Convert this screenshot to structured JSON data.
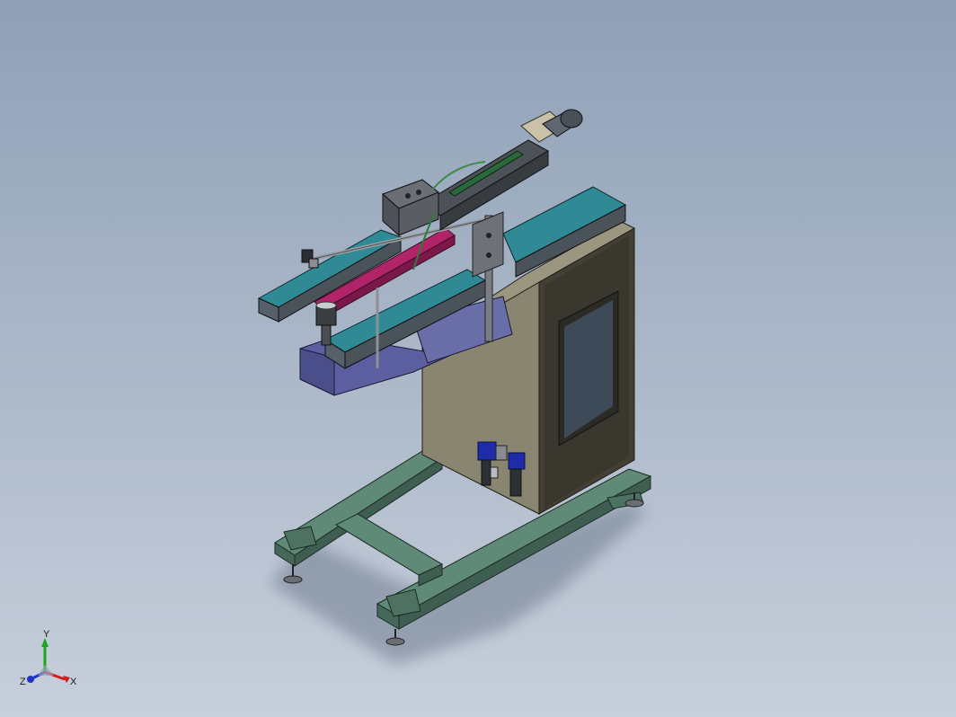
{
  "viewport": {
    "background_top": "#8fa0b6",
    "background_bottom": "#c7cfdb"
  },
  "model": {
    "colors": {
      "frame": "#5f8a78",
      "cabinet": "#8f8a73",
      "cabinet_dark": "#4a463a",
      "panel_window": "#3e4a58",
      "conveyor_belt": "#2f8a96",
      "conveyor_side": "#56606a",
      "rail": "#9a9ea3",
      "magenta_part": "#b1246a",
      "blue_part": "#1f2ca8",
      "purple_block": "#5b5fa0"
    }
  },
  "triad": {
    "x_label": "X",
    "y_label": "Y",
    "z_label": "Z",
    "x_color": "#d11c1c",
    "y_color": "#1aa81a",
    "z_color": "#1c32c8"
  }
}
